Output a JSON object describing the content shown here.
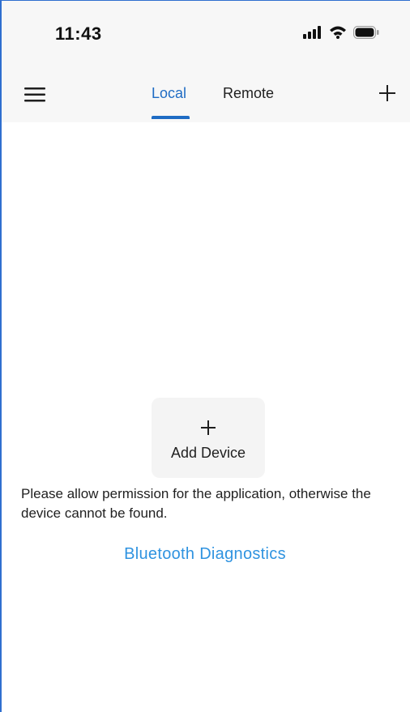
{
  "status_bar": {
    "time": "11:43",
    "signal_icon": "cellular-signal-icon",
    "wifi_icon": "wifi-icon",
    "battery_icon": "battery-icon"
  },
  "header": {
    "menu_icon": "hamburger-menu-icon",
    "tabs": [
      {
        "label": "Local",
        "selected": true
      },
      {
        "label": "Remote",
        "selected": false
      }
    ],
    "add_icon": "plus-icon",
    "accent_color": "#1f6cc4"
  },
  "main": {
    "add_device": {
      "icon": "plus-icon",
      "label": "Add Device"
    },
    "permission_message": "Please allow permission for the application, otherwise the device cannot be found.",
    "diagnostics_link": "Bluetooth Diagnostics",
    "link_color": "#2f93e0"
  }
}
